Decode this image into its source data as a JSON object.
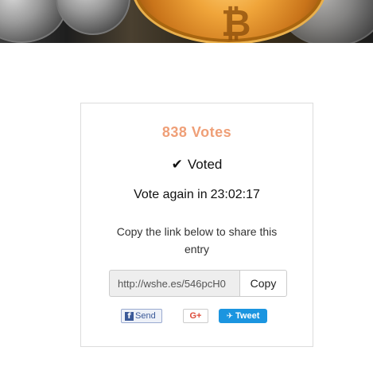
{
  "votes": {
    "count_text": "838 Votes",
    "color": "#ef9f77"
  },
  "status": {
    "check_icon": "check-icon",
    "voted_label": "Voted"
  },
  "vote_again": {
    "label": "Vote again in",
    "countdown": "23:02:17"
  },
  "share": {
    "instructions": "Copy the link below to share this entry",
    "link_value": "http://wshe.es/546pcH0",
    "copy_label": "Copy"
  },
  "social": {
    "facebook_label": "Send",
    "facebook_icon": "facebook-icon",
    "googleplus_label": "G+",
    "twitter_label": "Tweet",
    "twitter_icon": "twitter-bird-icon",
    "twitter_color": "#1b95e0"
  }
}
